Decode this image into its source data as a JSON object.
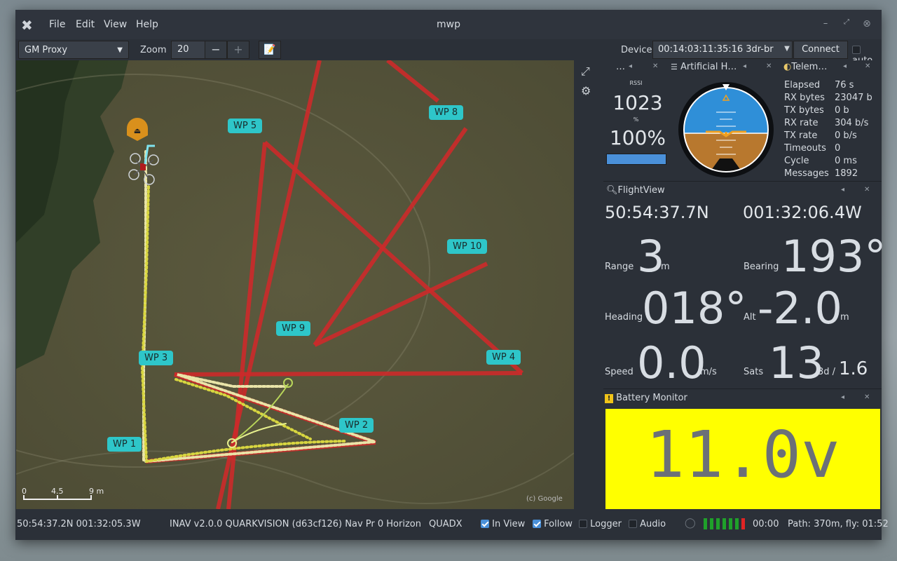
{
  "window": {
    "title": "mwp"
  },
  "menu": [
    "File",
    "Edit",
    "View",
    "Help"
  ],
  "toolbar": {
    "map_source": "GM Proxy",
    "zoom_label": "Zoom",
    "zoom_value": "20",
    "zoom_minus": "−",
    "zoom_plus": "+",
    "device_label": "Device",
    "device_value": "00:14:03:11:35:16 3dr-br",
    "connect_label": "Connect",
    "auto_label": "auto"
  },
  "map": {
    "waypoints": [
      "WP 1",
      "WP 2",
      "WP 3",
      "WP 4",
      "WP 5",
      "WP 8",
      "WP 9",
      "WP 10"
    ],
    "scale": [
      "0",
      "4.5",
      "9 m"
    ],
    "copyright": "(c) Google"
  },
  "rssi_panel": {
    "title": "…",
    "label": "RSSI",
    "value": "1023",
    "pct_sym": "%",
    "pct": "100%",
    "level": 1.0
  },
  "ahi_panel": {
    "title": "Artificial H…"
  },
  "telemetry": {
    "title": "Telem…",
    "rows": [
      {
        "k": "Elapsed",
        "v": "76 s"
      },
      {
        "k": "RX bytes",
        "v": "23047 b"
      },
      {
        "k": "TX bytes",
        "v": "0 b"
      },
      {
        "k": "RX rate",
        "v": "304 b/s"
      },
      {
        "k": "TX rate",
        "v": "0 b/s"
      },
      {
        "k": "Timeouts",
        "v": "0"
      },
      {
        "k": "Cycle",
        "v": "0 ms"
      },
      {
        "k": "Messages",
        "v": "1892"
      }
    ]
  },
  "flightview": {
    "title": "FlightView",
    "lat": "50:54:37.7N",
    "lon": "001:32:06.4W",
    "range_label": "Range",
    "range": "3",
    "range_unit": "m",
    "bearing_label": "Bearing",
    "bearing": "193°",
    "heading_label": "Heading",
    "heading": "018°",
    "alt_label": "Alt",
    "alt": "-2.0",
    "alt_unit": "m",
    "speed_label": "Speed",
    "speed": "0.0",
    "speed_unit": "m/s",
    "sats_label": "Sats",
    "sats": "13",
    "sats_fix": "3d /",
    "hdop": "1.6"
  },
  "battery": {
    "title": "Battery Monitor",
    "voltage": "11.0v",
    "color": "#ffff00"
  },
  "status": {
    "position": "50:54:37.2N 001:32:05.3W",
    "fc": "INAV v2.0.0  QUARKVISION (d63cf126) Nav Pr 0 Horizon",
    "frame": "QUADX",
    "in_view": "In View",
    "follow": "Follow",
    "logger": "Logger",
    "audio": "Audio",
    "timer": "00:00",
    "path": "Path: 370m, fly: 01:52"
  },
  "colors": {
    "accent": "#4a90d9",
    "waypoint": "#2ec6c9",
    "mission_line": "#cc2a2a",
    "battery_bg": "#ffff00"
  }
}
